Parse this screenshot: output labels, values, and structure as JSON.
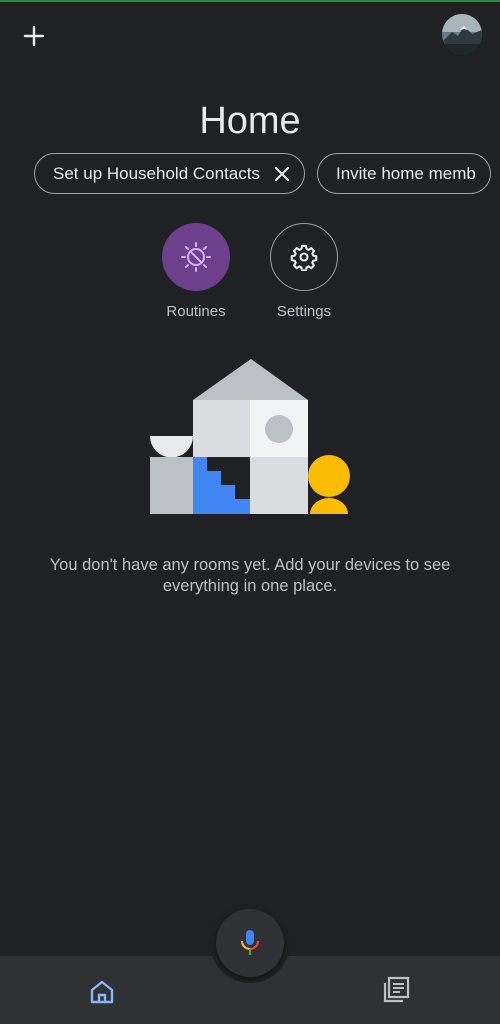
{
  "app": {
    "title": "Home",
    "accent_color": "#1e8e3e"
  },
  "header": {
    "add_icon": "plus-icon",
    "avatar_icon": "profile-avatar"
  },
  "chips": [
    {
      "label": "Set up Household Contacts",
      "dismiss_icon": "close-icon"
    },
    {
      "label": "Invite home memb"
    }
  ],
  "actions": [
    {
      "label": "Routines",
      "icon": "routines-icon",
      "color": "#6e3f8c"
    },
    {
      "label": "Settings",
      "icon": "gear-icon"
    }
  ],
  "empty_state": {
    "message": "You don't have any rooms yet. Add your devices to see everything in one place."
  },
  "bottom_nav": {
    "items": [
      {
        "icon": "home-icon",
        "active": true,
        "color": "#8ab4f8"
      },
      {
        "icon": "feed-icon",
        "active": false
      }
    ],
    "assistant_icon": "mic-icon"
  }
}
